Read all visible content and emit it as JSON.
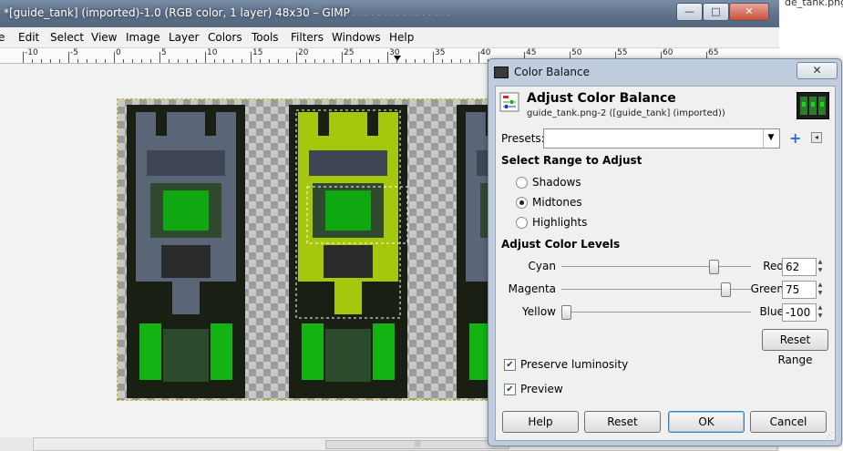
{
  "window": {
    "title": "*[guide_tank] (imported)-1.0 (RGB color, 1 layer) 48x30 – GIMP",
    "minimize_icon": "—",
    "maximize_icon": "□",
    "close_icon": "✕",
    "background_file_label": "de_tank.png"
  },
  "menu": [
    "e",
    "Edit",
    "Select",
    "View",
    "Image",
    "Layer",
    "Colors",
    "Tools",
    "Filters",
    "Windows",
    "Help"
  ],
  "ruler": {
    "labels": [
      "-10",
      "-5",
      "0",
      "5",
      "10",
      "15",
      "20",
      "25",
      "30",
      "35",
      "40",
      "45",
      "50",
      "55",
      "60",
      "65"
    ]
  },
  "canvas": {
    "selection_color": "#c6c200",
    "tank_colors": {
      "body": "#5a6578",
      "dark": "#1a1f14",
      "green": "#10a810",
      "highlight": "#a5c80c",
      "track": "#2c4a2c"
    }
  },
  "dialog": {
    "title": "Color Balance",
    "close_icon": "✕",
    "header_title": "Adjust Color Balance",
    "header_subtitle": "guide_tank.png-2 ([guide_tank] (imported))",
    "presets_label": "Presets:",
    "presets_value": "",
    "add_preset_icon": "+",
    "presets_menu_icon": "◂",
    "range_title": "Select Range to Adjust",
    "ranges": [
      {
        "label": "Shadows",
        "selected": false
      },
      {
        "label": "Midtones",
        "selected": true
      },
      {
        "label": "Highlights",
        "selected": false
      }
    ],
    "levels_title": "Adjust Color Levels",
    "sliders": [
      {
        "left": "Cyan",
        "right": "Red",
        "value": "62",
        "level": 62
      },
      {
        "left": "Magenta",
        "right": "Green",
        "value": "75",
        "level": 75
      },
      {
        "left": "Yellow",
        "right": "Blue",
        "value": "-100",
        "level": -100
      }
    ],
    "reset_range_label": "Reset Range",
    "preserve_luminosity": {
      "label": "Preserve luminosity",
      "checked": true
    },
    "preview": {
      "label": "Preview",
      "checked": true
    },
    "buttons": {
      "help": "Help",
      "reset": "Reset",
      "ok": "OK",
      "cancel": "Cancel"
    },
    "check_glyph": "✔",
    "spin_up": "▲",
    "spin_down": "▼",
    "dropdown_glyph": "▼"
  }
}
